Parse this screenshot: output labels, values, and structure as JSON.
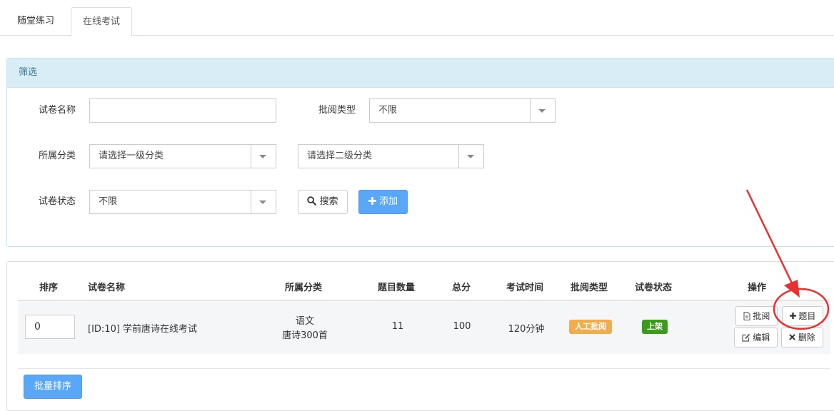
{
  "tabs": [
    "随堂练习",
    "在线考试"
  ],
  "filter": {
    "header": "筛选",
    "paper_name_label": "试卷名称",
    "paper_name_value": "",
    "review_type_label": "批阅类型",
    "review_type_value": "不限",
    "category_label": "所属分类",
    "category1_value": "请选择一级分类",
    "category2_value": "请选择二级分类",
    "status_label": "试卷状态",
    "status_value": "不限",
    "search_label": "搜索",
    "add_label": "添加"
  },
  "table": {
    "headers": [
      "排序",
      "试卷名称",
      "所属分类",
      "题目数量",
      "总分",
      "考试时间",
      "批阅类型",
      "试卷状态",
      "操作"
    ],
    "rows": [
      {
        "sort": "0",
        "name": "[ID:10] 学前唐诗在线考试",
        "category_line1": "语文",
        "category_line2": "唐诗300首",
        "count": "11",
        "score": "100",
        "time": "120分钟",
        "review_type": "人工批阅",
        "status": "上架",
        "actions": [
          "批阅",
          "题目",
          "编辑",
          "删除"
        ]
      }
    ],
    "batch_sort_label": "批量排序"
  },
  "colors": {
    "review_badge": "#f0ad4e",
    "status_badge": "#3c9b1c",
    "primary": "#5aa7f7",
    "annotation": "#e8312f"
  }
}
